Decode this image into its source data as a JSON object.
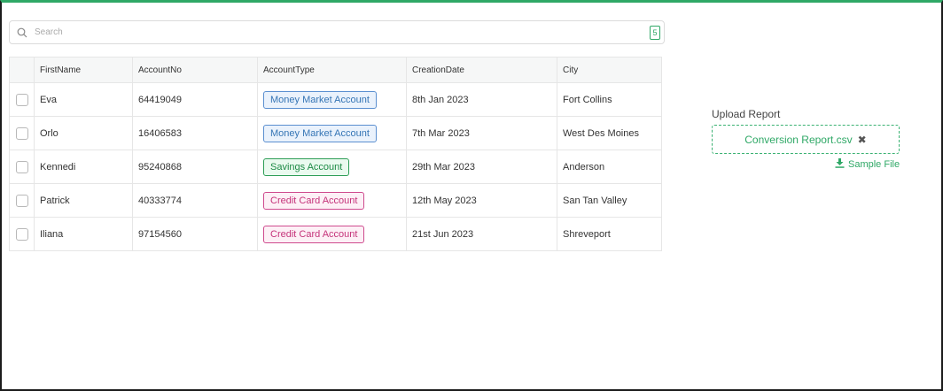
{
  "search": {
    "placeholder": "Search",
    "count": "5"
  },
  "table": {
    "headers": [
      "FirstName",
      "AccountNo",
      "AccountType",
      "CreationDate",
      "City"
    ],
    "rows": [
      {
        "first": "Eva",
        "account_no": "64419049",
        "type": "Money Market Account",
        "date": "8th Jan 2023",
        "city": "Fort Collins"
      },
      {
        "first": "Orlo",
        "account_no": "16406583",
        "type": "Money Market Account",
        "date": "7th Mar 2023",
        "city": "West Des Moines"
      },
      {
        "first": "Kennedi",
        "account_no": "95240868",
        "type": "Savings Account",
        "date": "29th Mar 2023",
        "city": "Anderson"
      },
      {
        "first": "Patrick",
        "account_no": "40333774",
        "type": "Credit Card Account",
        "date": "12th May 2023",
        "city": "San Tan Valley"
      },
      {
        "first": "Iliana",
        "account_no": "97154560",
        "type": "Credit Card Account",
        "date": "21st Jun 2023",
        "city": "Shreveport"
      }
    ]
  },
  "upload": {
    "label": "Upload Report",
    "file_name": "Conversion Report.csv",
    "remove_symbol": "✖",
    "sample_label": "Sample File"
  },
  "colors": {
    "accent": "#2fa866",
    "money_market": "#3575b5",
    "savings": "#1d8a45",
    "credit_card": "#c5337a"
  },
  "icons": {
    "search": "search-icon",
    "remove": "close-icon",
    "download": "download-icon"
  }
}
